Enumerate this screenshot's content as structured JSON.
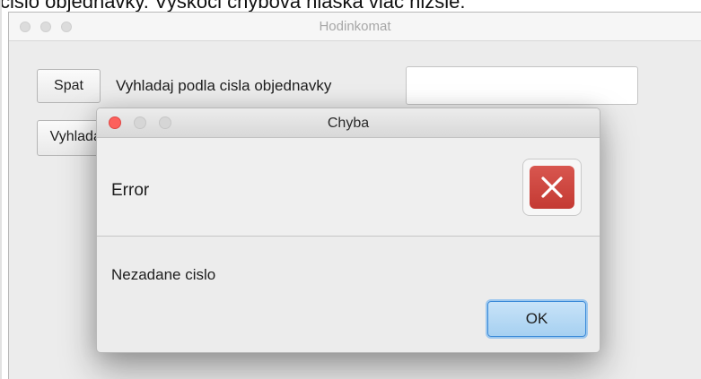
{
  "document": {
    "caption": "cislo objednavky. Vyskoci chybova hlaska viac nizsie:"
  },
  "main_window": {
    "title": "Hodinkomat",
    "back_button": "Spat",
    "search_label": "Vyhladaj podla cisla objednavky",
    "order_input_value": "",
    "search_button": "Vyhladaj"
  },
  "dialog": {
    "title": "Chyba",
    "header": "Error",
    "message": "Nezadane cislo",
    "ok_button": "OK",
    "close_color": "#fc605c",
    "icon": "error-x-icon",
    "icon_color": "#cc443e"
  }
}
